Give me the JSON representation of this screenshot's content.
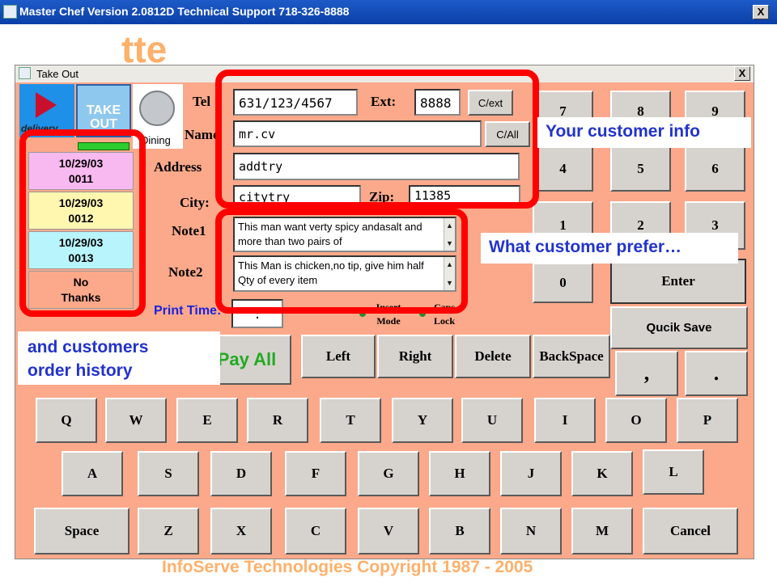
{
  "window": {
    "title": "Master Chef Version 2.0812D Technical Support 718-326-8888",
    "close": "X"
  },
  "background": {
    "logo_text": "tte",
    "footer": "InfoServe Technologies Copyright 1987 - 2005"
  },
  "dialog": {
    "title": "Take Out",
    "close": "X",
    "modes": {
      "delivery": "delivery",
      "takeout": "TAKE OUT",
      "dining": "Dining"
    },
    "labels": {
      "tel": "Tel",
      "ext": "Ext:",
      "name": "Name",
      "address": "Address",
      "city": "City:",
      "zip": "Zip:",
      "note1": "Note1",
      "note2": "Note2",
      "print_time": "Print Time:",
      "insert_mode": "Insert Mode",
      "caps_lock": "Caps Lock"
    },
    "fields": {
      "tel": "631/123/4567",
      "ext": "8888",
      "name": "mr.cv",
      "address": "addtry",
      "city": "citytry",
      "zip": "11385",
      "print_time": ":",
      "note1": "This man want verty spicy andasalt and more than two pairs of",
      "note2": "This Man is chicken,no tip, give him half Qty of every item"
    },
    "buttons": {
      "clear_ext": "C/ext",
      "clear_all": "C/All",
      "pay_all": "Pay All"
    },
    "orders": [
      {
        "date": "10/29/03",
        "num": "0011",
        "color": "#f8b8f0"
      },
      {
        "date": "10/29/03",
        "num": "0012",
        "color": "#fff7b0"
      },
      {
        "date": "10/29/03",
        "num": "0013",
        "color": "#b8f4fc"
      }
    ],
    "no_thanks": "No Thanks",
    "numpad": {
      "k7": "7",
      "k8": "8",
      "k9": "9",
      "k4": "4",
      "k5": "5",
      "k6": "6",
      "k1": "1",
      "k2": "2",
      "k3": "3",
      "k0": "0",
      "enter": "Enter",
      "quick_save": "Qucik Save",
      "comma": ",",
      "period": "."
    },
    "edit_keys": {
      "left": "Left",
      "right": "Right",
      "delete": "Delete",
      "backspace": "BackSpace"
    },
    "row1": [
      "Q",
      "W",
      "E",
      "R",
      "T",
      "Y",
      "U",
      "I",
      "O",
      "P"
    ],
    "row2": [
      "A",
      "S",
      "D",
      "F",
      "G",
      "H",
      "J",
      "K",
      "L"
    ],
    "row3": {
      "space": "Space",
      "letters": [
        "Z",
        "X",
        "C",
        "V",
        "B",
        "N",
        "M"
      ],
      "cancel": "Cancel"
    }
  },
  "callouts": {
    "customer_info": "Your customer info",
    "prefer": "What customer prefer…",
    "history_1": "and customers",
    "history_2": "order history"
  },
  "colors": {
    "highlight": "#ff0000",
    "callout_text": "#2233cc",
    "dialog_bg": "#fba98a"
  }
}
